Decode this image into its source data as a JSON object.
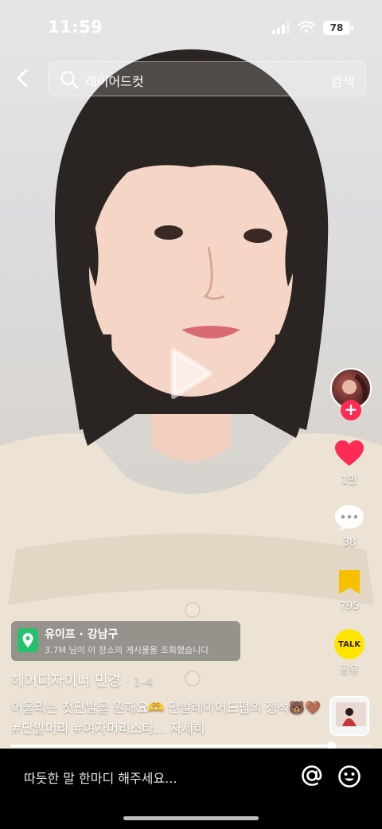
{
  "status_bar": {
    "time": "11:59",
    "battery": "78"
  },
  "search": {
    "query": "레이어드컷",
    "submit_label": "검색"
  },
  "actions": {
    "likes": "1만",
    "comments": "38",
    "saves": "795",
    "share_label": "공유",
    "talk_label": "TALK"
  },
  "location": {
    "name": "유이프 · 강남구",
    "views": "3.7M 님이 이 장소의 게시물을 조회했습니다"
  },
  "post": {
    "author": "헤어디자이너 민경",
    "date": "· 1-4",
    "caption": "어울리는 첫단발을 원해요🫶 단발레이어드펌의 정석🐻🤎 #단발머리 #여자머리스타... ",
    "more_label": "자세히"
  },
  "playback": {
    "progress": 0.89
  },
  "comment_bar": {
    "placeholder": "따듯한 말 한마디 해주세요..."
  },
  "colors": {
    "accent": "#fe2c55",
    "like": "#fe2c55",
    "save": "#f6c000",
    "kakao": "#fee500",
    "location_pin": "#25c26e"
  },
  "icons": [
    "back-icon",
    "search-icon",
    "play-icon",
    "heart-icon",
    "comment-icon",
    "bookmark-icon",
    "kakao-talk-icon",
    "at-icon",
    "emoji-icon",
    "location-pin-icon"
  ]
}
